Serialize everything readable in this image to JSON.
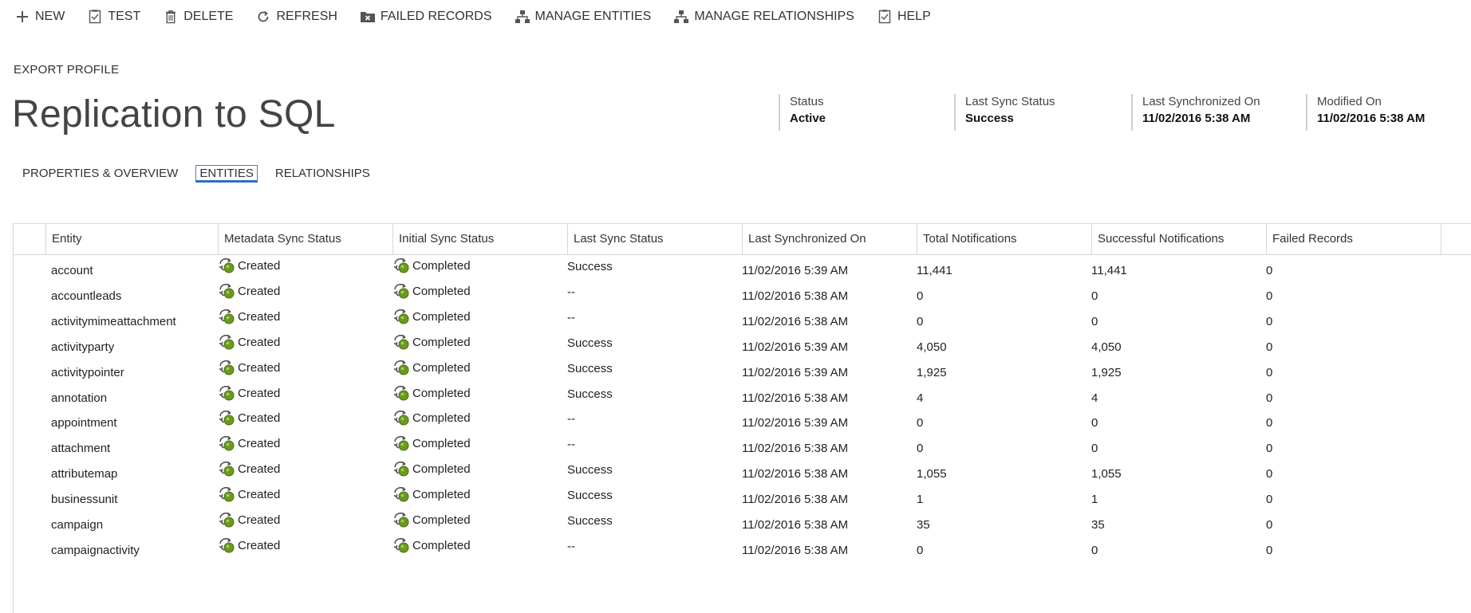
{
  "toolbar": {
    "new": "NEW",
    "test": "TEST",
    "delete": "DELETE",
    "refresh": "REFRESH",
    "failed_records": "FAILED RECORDS",
    "manage_entities": "MANAGE ENTITIES",
    "manage_relationships": "MANAGE RELATIONSHIPS",
    "help": "HELP"
  },
  "breadcrumb": "EXPORT PROFILE",
  "title": "Replication to SQL",
  "header_fields": [
    {
      "label": "Status",
      "value": "Active"
    },
    {
      "label": "Last Sync Status",
      "value": "Success"
    },
    {
      "label": "Last Synchronized On",
      "value": "11/02/2016 5:38 AM"
    },
    {
      "label": "Modified On",
      "value": "11/02/2016 5:38 AM"
    }
  ],
  "tabs": [
    "PROPERTIES & OVERVIEW",
    "ENTITIES",
    "RELATIONSHIPS"
  ],
  "active_tab": "ENTITIES",
  "grid": {
    "columns": [
      "Entity",
      "Metadata Sync Status",
      "Initial Sync Status",
      "Last Sync Status",
      "Last Synchronized On",
      "Total Notifications",
      "Successful Notifications",
      "Failed Records"
    ],
    "rows": [
      [
        "account",
        "Created",
        "Completed",
        "Success",
        "11/02/2016 5:39 AM",
        "11,441",
        "11,441",
        "0"
      ],
      [
        "accountleads",
        "Created",
        "Completed",
        "--",
        "11/02/2016 5:38 AM",
        "0",
        "0",
        "0"
      ],
      [
        "activitymimeattachment",
        "Created",
        "Completed",
        "--",
        "11/02/2016 5:38 AM",
        "0",
        "0",
        "0"
      ],
      [
        "activityparty",
        "Created",
        "Completed",
        "Success",
        "11/02/2016 5:39 AM",
        "4,050",
        "4,050",
        "0"
      ],
      [
        "activitypointer",
        "Created",
        "Completed",
        "Success",
        "11/02/2016 5:39 AM",
        "1,925",
        "1,925",
        "0"
      ],
      [
        "annotation",
        "Created",
        "Completed",
        "Success",
        "11/02/2016 5:38 AM",
        "4",
        "4",
        "0"
      ],
      [
        "appointment",
        "Created",
        "Completed",
        "--",
        "11/02/2016 5:39 AM",
        "0",
        "0",
        "0"
      ],
      [
        "attachment",
        "Created",
        "Completed",
        "--",
        "11/02/2016 5:38 AM",
        "0",
        "0",
        "0"
      ],
      [
        "attributemap",
        "Created",
        "Completed",
        "Success",
        "11/02/2016 5:38 AM",
        "1,055",
        "1,055",
        "0"
      ],
      [
        "businessunit",
        "Created",
        "Completed",
        "Success",
        "11/02/2016 5:38 AM",
        "1",
        "1",
        "0"
      ],
      [
        "campaign",
        "Created",
        "Completed",
        "Success",
        "11/02/2016 5:38 AM",
        "35",
        "35",
        "0"
      ],
      [
        "campaignactivity",
        "Created",
        "Completed",
        "--",
        "11/02/2016 5:38 AM",
        "0",
        "0",
        "0"
      ]
    ]
  },
  "icons": {
    "new": "plus-icon",
    "test": "checklist-icon",
    "delete": "trash-icon",
    "refresh": "refresh-icon",
    "failed_records": "failed-records-icon",
    "manage_entities": "hierarchy-icon",
    "manage_relationships": "hierarchy-icon",
    "help": "help-doc-icon",
    "sync_status": "sync-success-icon"
  },
  "colors": {
    "status_green": "#6a9a1f",
    "tab_accent": "#2e6fc1",
    "grid_border": "#d8d8d8"
  }
}
